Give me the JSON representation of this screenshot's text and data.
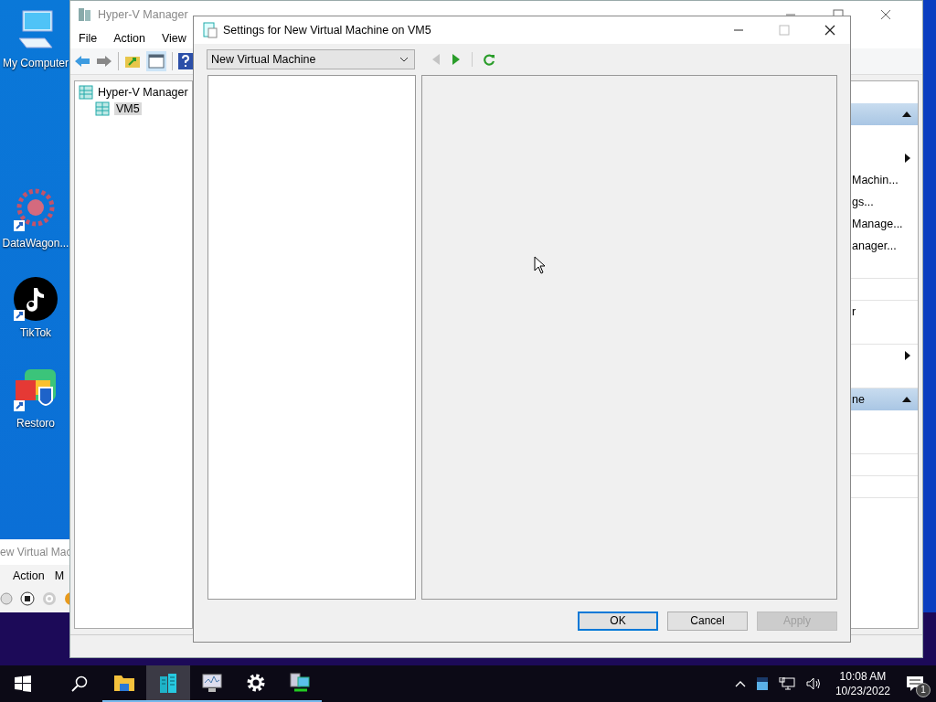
{
  "desktop_icons": [
    {
      "label": "My Computer",
      "kind": "computer"
    },
    {
      "label": "DataWagon...",
      "kind": "gear"
    },
    {
      "label": "TikTok",
      "kind": "note"
    },
    {
      "label": "Restoro",
      "kind": "tiles"
    }
  ],
  "background_window": {
    "title": "ew Virtual Mac",
    "menu": [
      "Action",
      "M"
    ]
  },
  "hyperv_window": {
    "title": "Hyper-V Manager",
    "menu": [
      "File",
      "Action",
      "View"
    ],
    "tree": [
      {
        "label": "Hyper-V Manager",
        "selected": false,
        "children": [
          {
            "label": "VM5",
            "selected": true
          }
        ]
      }
    ],
    "actions": [
      {
        "kind": "header"
      },
      {
        "kind": "item",
        "submenu": true
      },
      {
        "kind": "item",
        "label": "Machin..."
      },
      {
        "kind": "item",
        "label": "gs..."
      },
      {
        "kind": "item",
        "label": "Manage..."
      },
      {
        "kind": "item",
        "label": "anager..."
      },
      {
        "kind": "separator"
      },
      {
        "kind": "separator"
      },
      {
        "kind": "item",
        "label": "r"
      },
      {
        "kind": "separator"
      },
      {
        "kind": "item",
        "submenu": true
      },
      {
        "kind": "separator"
      },
      {
        "kind": "header",
        "label": "ne"
      },
      {
        "kind": "separator"
      },
      {
        "kind": "separator"
      },
      {
        "kind": "separator"
      }
    ]
  },
  "dialog": {
    "title": "Settings for New Virtual Machine on VM5",
    "dropdown": {
      "value": "New Virtual Machine"
    },
    "nav": [
      {
        "kind": "back",
        "disabled": true
      },
      {
        "kind": "forward",
        "disabled": false
      },
      {
        "kind": "refresh",
        "disabled": false
      }
    ],
    "buttons": [
      {
        "label": "OK",
        "default": true,
        "disabled": false
      },
      {
        "label": "Cancel",
        "default": false,
        "disabled": false
      },
      {
        "label": "Apply",
        "default": false,
        "disabled": true
      }
    ]
  },
  "taskbar": {
    "apps": [
      {
        "kind": "folder",
        "selected": false
      },
      {
        "kind": "servers",
        "selected": true
      },
      {
        "kind": "monitor",
        "selected": false
      },
      {
        "kind": "gear",
        "selected": false
      },
      {
        "kind": "network",
        "selected": false
      }
    ],
    "time": "10:08 AM",
    "date": "10/23/2022",
    "notification_count": "1"
  }
}
